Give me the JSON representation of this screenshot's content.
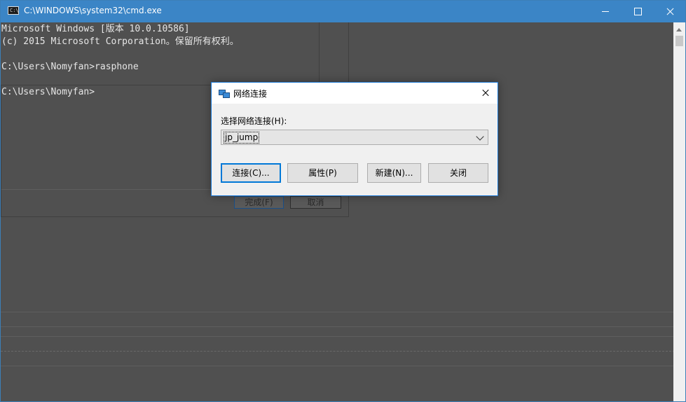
{
  "window": {
    "title": "C:\\WINDOWS\\system32\\cmd.exe",
    "icon_name": "console-app-icon",
    "icon_text": "C:\\",
    "controls": [
      "minimize-icon",
      "maximize-icon",
      "close-icon"
    ]
  },
  "console": {
    "lines": [
      "Microsoft Windows [版本 10.0.10586]",
      "(c) 2015 Microsoft Corporation。保留所有权利。",
      "",
      "C:\\Users\\Nomyfan>rasphone",
      "",
      "C:\\Users\\Nomyfan>"
    ]
  },
  "background_dialog": {
    "ok_label": "完成(F)",
    "cancel_label": "取消"
  },
  "dialog": {
    "title": "网络连接",
    "icon_name": "network-connections-icon",
    "select_label": "选择网络连接(H):",
    "selected_connection": "jp_jump",
    "buttons": {
      "connect": "连接(C)...",
      "properties": "属性(P)",
      "new": "新建(N)...",
      "close": "关闭"
    }
  },
  "colors": {
    "titlebar": "#3b85c6",
    "console_bg": "#505050",
    "dialog_accent": "#0078d7"
  }
}
